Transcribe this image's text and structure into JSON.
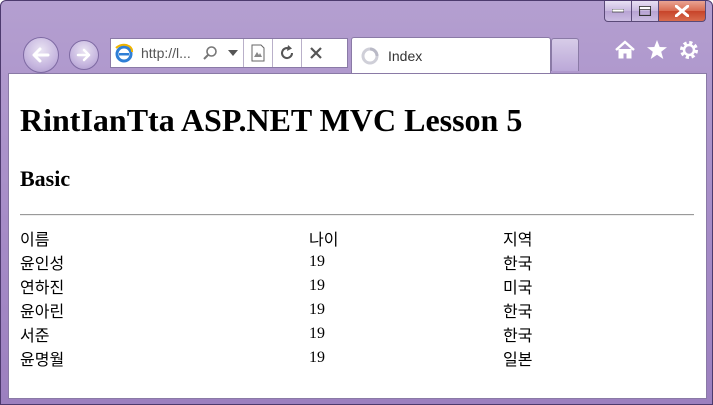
{
  "browser": {
    "address_text": "http://l...",
    "tab_label": "Index"
  },
  "page": {
    "title": "RintIanTta ASP.NET MVC Lesson 5",
    "subtitle": "Basic",
    "table": {
      "headers": [
        "이름",
        "나이",
        "지역"
      ],
      "rows": [
        [
          "윤인성",
          "19",
          "한국"
        ],
        [
          "연하진",
          "19",
          "미국"
        ],
        [
          "윤아린",
          "19",
          "한국"
        ],
        [
          "서준",
          "19",
          "한국"
        ],
        [
          "윤명월",
          "19",
          "일본"
        ]
      ]
    }
  }
}
